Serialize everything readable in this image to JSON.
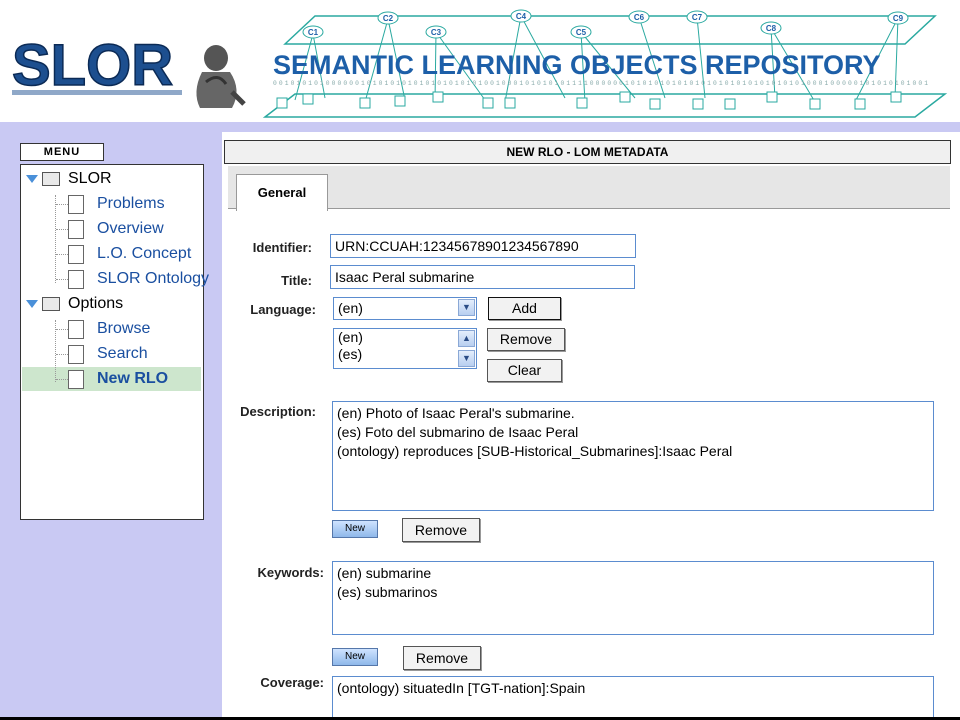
{
  "header": {
    "logo_text": "SLOR",
    "banner_title": "SEMANTIC LEARNING OBJECTS REPOSITORY",
    "banner_bits": "0010101010000001010101010101010101010010001010101011110000001010101010101010101010101010101000100000101010101001",
    "concept_nodes": [
      "C1",
      "C2",
      "C3",
      "C4",
      "C5",
      "C6",
      "C7",
      "C8",
      "C9"
    ]
  },
  "sidebar": {
    "menu_label": "MENU",
    "tree": [
      {
        "label": "SLOR",
        "type": "folder",
        "level": 0
      },
      {
        "label": "Problems",
        "type": "doc",
        "level": 1
      },
      {
        "label": "Overview",
        "type": "doc",
        "level": 1
      },
      {
        "label": "L.O. Concept",
        "type": "doc",
        "level": 1
      },
      {
        "label": "SLOR Ontology",
        "type": "doc",
        "level": 1
      },
      {
        "label": "Options",
        "type": "folder",
        "level": 0
      },
      {
        "label": "Browse",
        "type": "doc",
        "level": 1
      },
      {
        "label": "Search",
        "type": "doc",
        "level": 1
      },
      {
        "label": "New RLO",
        "type": "doc",
        "level": 1,
        "selected": true
      }
    ]
  },
  "main": {
    "title": "NEW RLO - LOM METADATA",
    "tabs": [
      {
        "label": "General",
        "active": true
      }
    ],
    "form": {
      "identifier_label": "Identifier:",
      "identifier_value": "URN:CCUAH:12345678901234567890",
      "title_label": "Title:",
      "title_value": "Isaac Peral submarine",
      "language_label": "Language:",
      "language_selected": "(en)",
      "language_list": [
        "(en)",
        "(es)"
      ],
      "add_label": "Add",
      "remove_label": "Remove",
      "clear_label": "Clear",
      "description_label": "Description:",
      "description_lines": [
        "(en) Photo of Isaac Peral's submarine.",
        "(es) Foto del submarino de Isaac Peral",
        "(ontology) reproduces [SUB-Historical_Submarines]:Isaac Peral"
      ],
      "new_label": "New",
      "desc_remove_label": "Remove",
      "keywords_label": "Keywords:",
      "keywords_lines": [
        "(en) submarine",
        "(es) submarinos"
      ],
      "kw_new_label": "New",
      "kw_remove_label": "Remove",
      "coverage_label": "Coverage:",
      "coverage_lines": [
        "(ontology) situatedIn [TGT-nation]:Spain"
      ]
    }
  },
  "colors": {
    "sidebar_bg": "#c9c9f3",
    "banner_teal": "#2aa9a0",
    "banner_blue": "#1d5fa8",
    "selected_row": "#cde6cd",
    "link": "#1a4fa0"
  }
}
